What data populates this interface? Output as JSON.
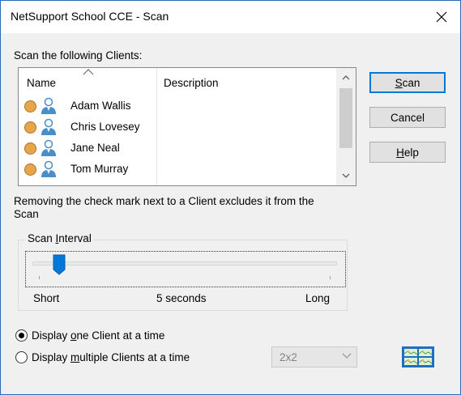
{
  "window": {
    "title": "NetSupport School CCE - Scan",
    "close_glyph": "✕"
  },
  "clients": {
    "section_label": "Scan the following Clients:",
    "columns": {
      "name": "Name",
      "description": "Description"
    },
    "rows": [
      {
        "name": "Adam Wallis",
        "status_color": "#e8a64a",
        "icon": "person-icon"
      },
      {
        "name": "Chris Lovesey",
        "status_color": "#e8a64a",
        "icon": "person-icon"
      },
      {
        "name": "Jane Neal",
        "status_color": "#e8a64a",
        "icon": "person-icon"
      },
      {
        "name": "Tom Murray",
        "status_color": "#e8a64a",
        "icon": "person-icon"
      }
    ]
  },
  "buttons": {
    "scan_prefix": "S",
    "scan_rest": "can",
    "cancel": "Cancel",
    "help_prefix": "H",
    "help_rest": "elp"
  },
  "hint": "Removing the check mark next to a Client excludes it from the Scan",
  "interval": {
    "group_prefix": "Scan ",
    "group_accel": "I",
    "group_rest": "nterval",
    "min_label": "Short",
    "value_label": "5 seconds",
    "max_label": "Long",
    "slider_position": 0.07
  },
  "display": {
    "one_prefix": "Display ",
    "one_accel": "o",
    "one_rest": "ne Client at a time",
    "multi_prefix": "Display ",
    "multi_accel": "m",
    "multi_rest": "ultiple Clients at a time",
    "selected": "one",
    "layout_value": "2x2",
    "layout_icon": "grid-layout-icon"
  },
  "colors": {
    "accent": "#0078d7",
    "status_online": "#e8a64a",
    "person_icon": "#4a8ec8"
  }
}
